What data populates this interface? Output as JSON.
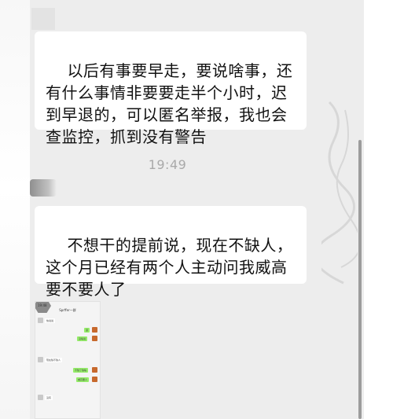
{
  "chat": {
    "messages": [
      {
        "id": "msg1",
        "side": "received",
        "text": "以后有事要早走，要说啥事，还有什么事情非要要走半个小时，迟到早退的，可以匿名举报，我也会查监控，抓到没有警告"
      },
      {
        "id": "msg2",
        "side": "received",
        "text": "不想干的提前说，现在不缺人，这个月已经有两个人主动问我威高要不要人了"
      }
    ],
    "timestamp": "19:49"
  },
  "colors": {
    "chat_background": "#ededed",
    "bubble_received": "#ffffff",
    "bubble_sent": "#95ec69",
    "timestamp_text": "#a9a9a9"
  },
  "thumbnail": {
    "status_time": "19:48",
    "title": "Sprffer一群",
    "messages": [
      {
        "side": "received",
        "text": "快说说"
      },
      {
        "side": "sent",
        "text": "滚"
      },
      {
        "side": "sent",
        "text": "没啥说"
      },
      {
        "side": "received",
        "text": "现在缺不缺人"
      },
      {
        "side": "sent",
        "text": "不缺了缺啥"
      },
      {
        "side": "sent",
        "text": "威高要人"
      },
      {
        "side": "received",
        "text": "没有"
      }
    ]
  }
}
